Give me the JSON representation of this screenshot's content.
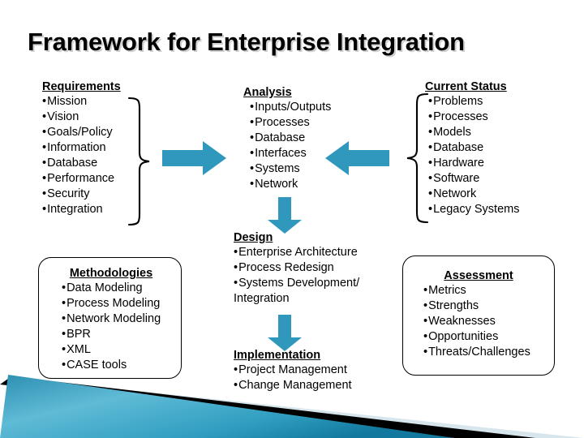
{
  "slide": {
    "title": "Framework for Enterprise Integration",
    "background_color": "#ffffff",
    "accent_color": "#3098BC",
    "text_color": "#000000"
  },
  "blocks": {
    "requirements": {
      "heading": "Requirements",
      "items": [
        "Mission",
        "Vision",
        "Goals/Policy",
        "Information",
        "Database",
        "Performance",
        "Security",
        "Integration"
      ]
    },
    "analysis": {
      "heading": "Analysis",
      "items": [
        "Inputs/Outputs",
        "Processes",
        "Database",
        "Interfaces",
        "Systems",
        "Network"
      ]
    },
    "current_status": {
      "heading": "Current Status",
      "items": [
        "Problems",
        "Processes",
        "Models",
        "Database",
        "Hardware",
        "Software",
        "Network",
        "Legacy Systems"
      ]
    },
    "methodologies": {
      "heading": "Methodologies",
      "items": [
        "Data Modeling",
        "Process Modeling",
        "Network Modeling",
        "BPR",
        "XML",
        "CASE tools"
      ]
    },
    "design": {
      "heading": "Design",
      "items": [
        "Enterprise Architecture",
        "Process Redesign",
        "Systems Development/"
      ],
      "continuation": "Integration"
    },
    "implementation": {
      "heading": "Implementation",
      "items": [
        "Project Management",
        "Change Management"
      ]
    },
    "assessment": {
      "heading": "Assessment",
      "items": [
        "Metrics",
        "Strengths",
        "Weaknesses",
        "Opportunities",
        "Threats/Challenges"
      ]
    }
  },
  "connectors": [
    {
      "name": "arrow-right-requirements-to-analysis",
      "direction": "right"
    },
    {
      "name": "arrow-left-status-to-analysis",
      "direction": "left"
    },
    {
      "name": "arrow-down-analysis-to-design",
      "direction": "down"
    },
    {
      "name": "arrow-down-design-to-implementation",
      "direction": "down"
    },
    {
      "name": "brace-requirements",
      "direction": "right"
    },
    {
      "name": "brace-current-status",
      "direction": "left"
    }
  ],
  "decoration": {
    "teal_light": "#4FB2CF",
    "teal_dark": "#1782A6",
    "black": "#000000",
    "pale": "#D7E5EC"
  }
}
